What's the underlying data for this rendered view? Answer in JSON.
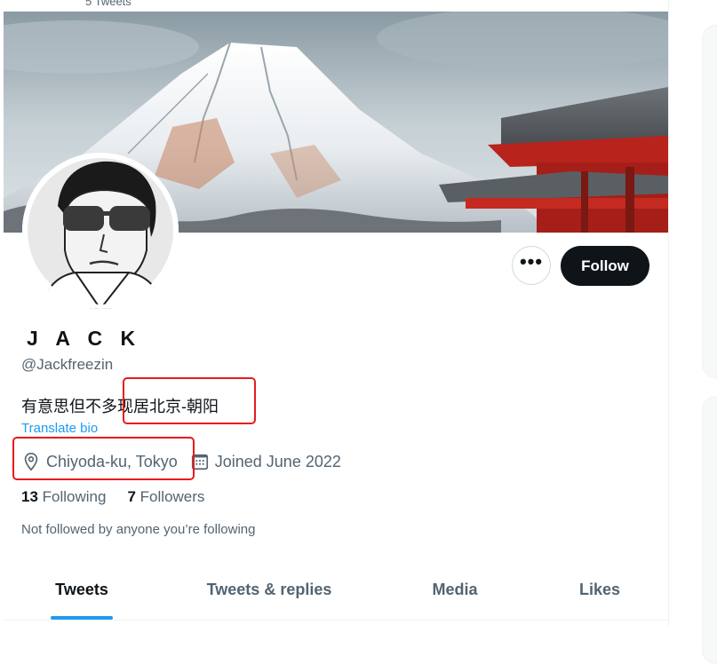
{
  "header": {
    "tweet_count": "5 Tweets"
  },
  "profile": {
    "display_name": "J A C K",
    "handle": "@Jackfreezin",
    "bio_part1": "有意思但不多",
    "bio_part2": "现居北京-朝阳",
    "translate_label": "Translate bio",
    "location": "Chiyoda-ku, Tokyo",
    "joined": "Joined June 2022",
    "following_count": "13",
    "following_label": "Following",
    "followers_count": "7",
    "followers_label": "Followers",
    "not_followed": "Not followed by anyone you’re following"
  },
  "actions": {
    "more_label": "•••",
    "follow_label": "Follow"
  },
  "tabs": [
    {
      "label": "Tweets",
      "active": true
    },
    {
      "label": "Tweets & replies",
      "active": false
    },
    {
      "label": "Media",
      "active": false
    },
    {
      "label": "Likes",
      "active": false
    }
  ],
  "icons": {
    "more": "more-icon",
    "location": "location-pin-icon",
    "calendar": "calendar-icon"
  },
  "colors": {
    "accent": "#1d9bf0",
    "follow_bg": "#0f1419",
    "annotation": "#e81b1b",
    "muted": "#536471"
  }
}
